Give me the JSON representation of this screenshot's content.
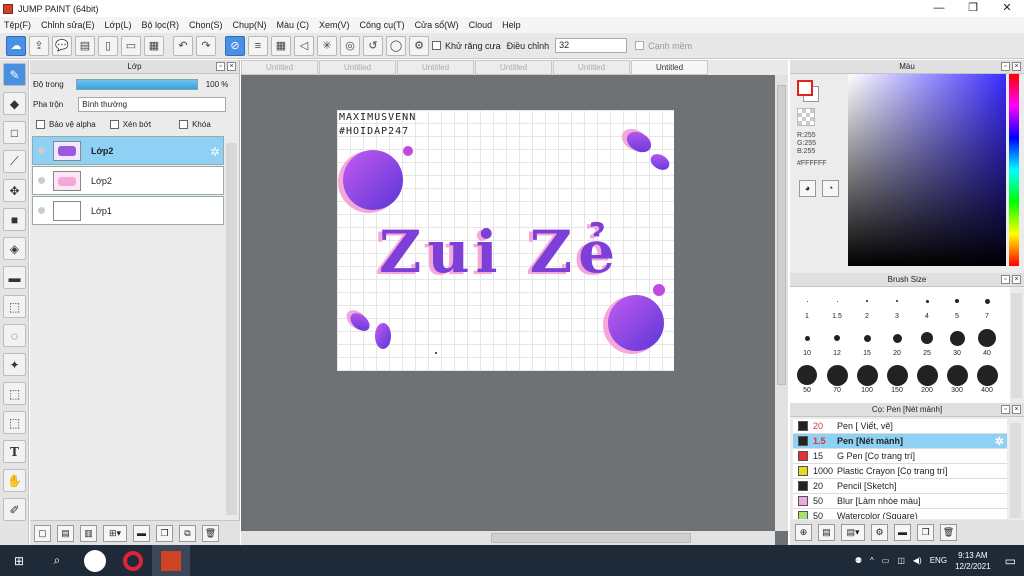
{
  "window": {
    "title": "JUMP PAINT (64bit)",
    "minimize": "—",
    "maximize": "❐",
    "close": "✕"
  },
  "menu": [
    "Tệp(F)",
    "Chỉnh sửa(E)",
    "Lớp(L)",
    "Bộ lọc(R)",
    "Chọn(S)",
    "Chụp(N)",
    "Màu (C)",
    "Xem(V)",
    "Công cụ(T)",
    "Cửa sổ(W)",
    "Cloud",
    "Help"
  ],
  "toolbar": {
    "antialias_label": "Khử răng cưa",
    "adjust_label": "Điều chỉnh",
    "adjust_value": "32",
    "snap_label": "Cạnh mềm"
  },
  "layer_panel": {
    "title": "Lớp",
    "opacity_label": "Độ trong",
    "opacity_value": "100 %",
    "blend_label": "Pha trộn",
    "blend_value": "Bình thường",
    "protect_alpha": "Bảo vệ alpha",
    "clip": "Xén bớt",
    "lock": "Khóa",
    "layers": [
      {
        "name": "Lớp2",
        "selected": true
      },
      {
        "name": "Lớp2",
        "selected": false
      },
      {
        "name": "Lớp1",
        "selected": false
      }
    ]
  },
  "tabs": [
    "Untitled",
    "Untitled",
    "Untitled",
    "Untitled",
    "Untitled",
    "Untitled"
  ],
  "canvas": {
    "signature_line1": "MAXIMUSVENN",
    "signature_line2": "#HOIDAP247",
    "artwork_text": "Zui Zẻ"
  },
  "color_panel": {
    "title": "Màu",
    "r": "R:255",
    "g": "G:255",
    "b": "B:255",
    "hex": "#FFFFFF"
  },
  "brush_panel": {
    "title": "Brush Size",
    "sizes": [
      "1",
      "1.5",
      "2",
      "3",
      "4",
      "5",
      "7",
      "10",
      "12",
      "15",
      "20",
      "25",
      "30",
      "40",
      "50",
      "70",
      "100",
      "150",
      "200",
      "300",
      "400"
    ]
  },
  "pen_panel": {
    "title": "Cọ: Pen [Nét mảnh]",
    "items": [
      {
        "size": "20",
        "name": "Pen [ Viết, vẽ]",
        "color": "#222222"
      },
      {
        "size": "1.5",
        "name": "Pen [Nét mảnh]",
        "color": "#222222"
      },
      {
        "size": "15",
        "name": "G Pen [Cọ trang trí]",
        "color": "#e03030"
      },
      {
        "size": "1000",
        "name": "Plastic Crayon [Cọ trang trí]",
        "color": "#e8d820"
      },
      {
        "size": "20",
        "name": "Pencil [Sketch]",
        "color": "#222222"
      },
      {
        "size": "50",
        "name": "Blur [Làm nhòe màu]",
        "color": "#f0a8e0"
      },
      {
        "size": "50",
        "name": "Watercolor (Square)",
        "color": "#a8e070"
      }
    ]
  },
  "taskbar": {
    "lang": "ENG",
    "time": "9:13 AM",
    "date": "12/2/2021"
  }
}
